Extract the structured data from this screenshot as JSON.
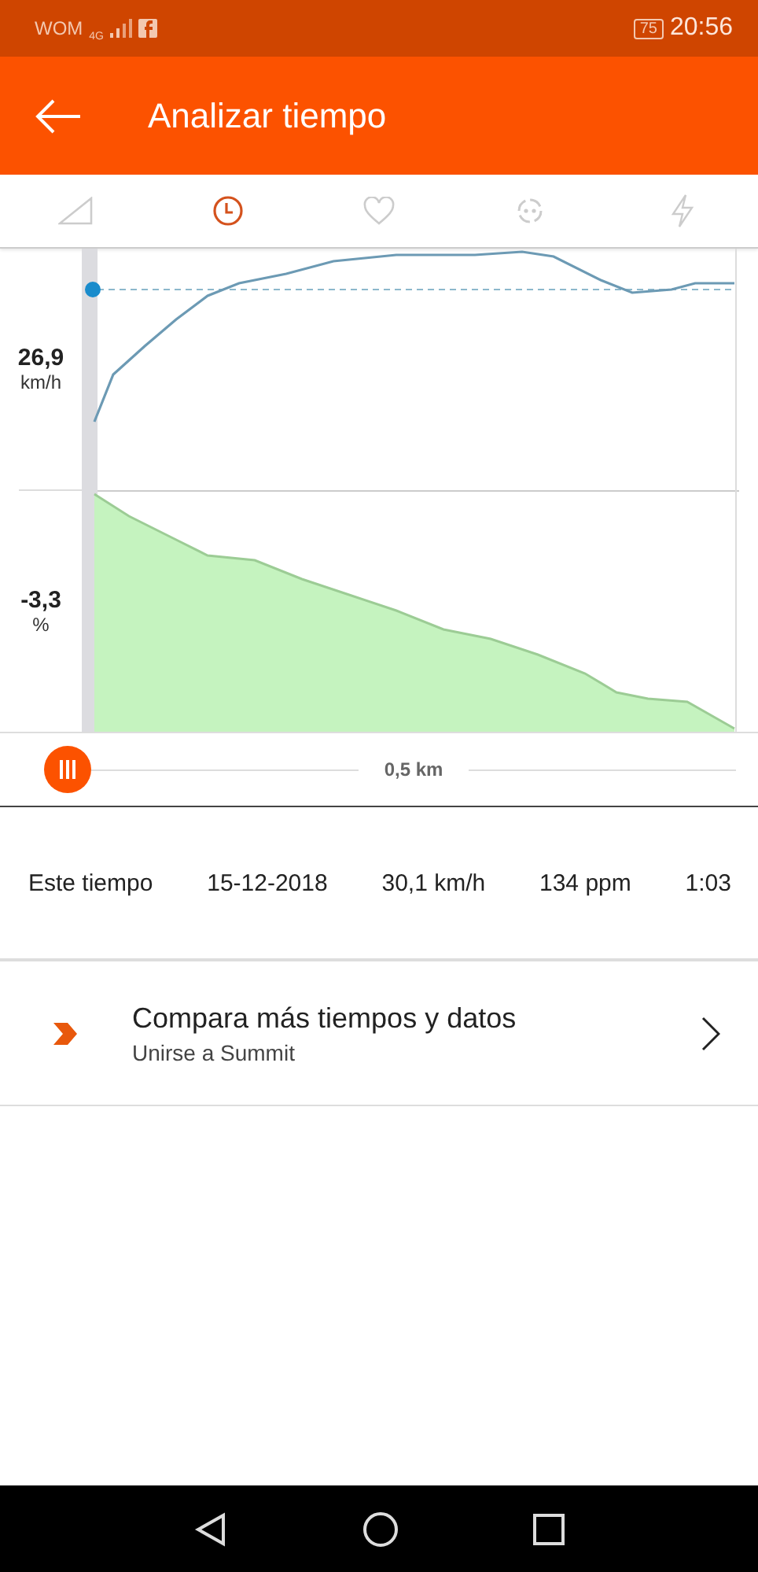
{
  "status_bar": {
    "carrier": "WOM",
    "network": "4G",
    "battery": "75",
    "time": "20:56"
  },
  "app_bar": {
    "title": "Analizar tiempo"
  },
  "tabs": [
    {
      "kind": "grade",
      "selected": false
    },
    {
      "kind": "time",
      "selected": true
    },
    {
      "kind": "heart",
      "selected": false
    },
    {
      "kind": "cadence",
      "selected": false
    },
    {
      "kind": "power",
      "selected": false
    }
  ],
  "chart": {
    "speed": {
      "value": "26,9",
      "unit": "km/h"
    },
    "grade": {
      "value": "-3,3",
      "unit": "%"
    }
  },
  "scrubber": {
    "distance": "0,5 km"
  },
  "effort_row": [
    "Este tiempo",
    "15-12-2018",
    "30,1 km/h",
    "134 ppm",
    "1:03"
  ],
  "promo": {
    "title": "Compara más tiempos y datos",
    "subtitle": "Unirse a Summit"
  }
}
